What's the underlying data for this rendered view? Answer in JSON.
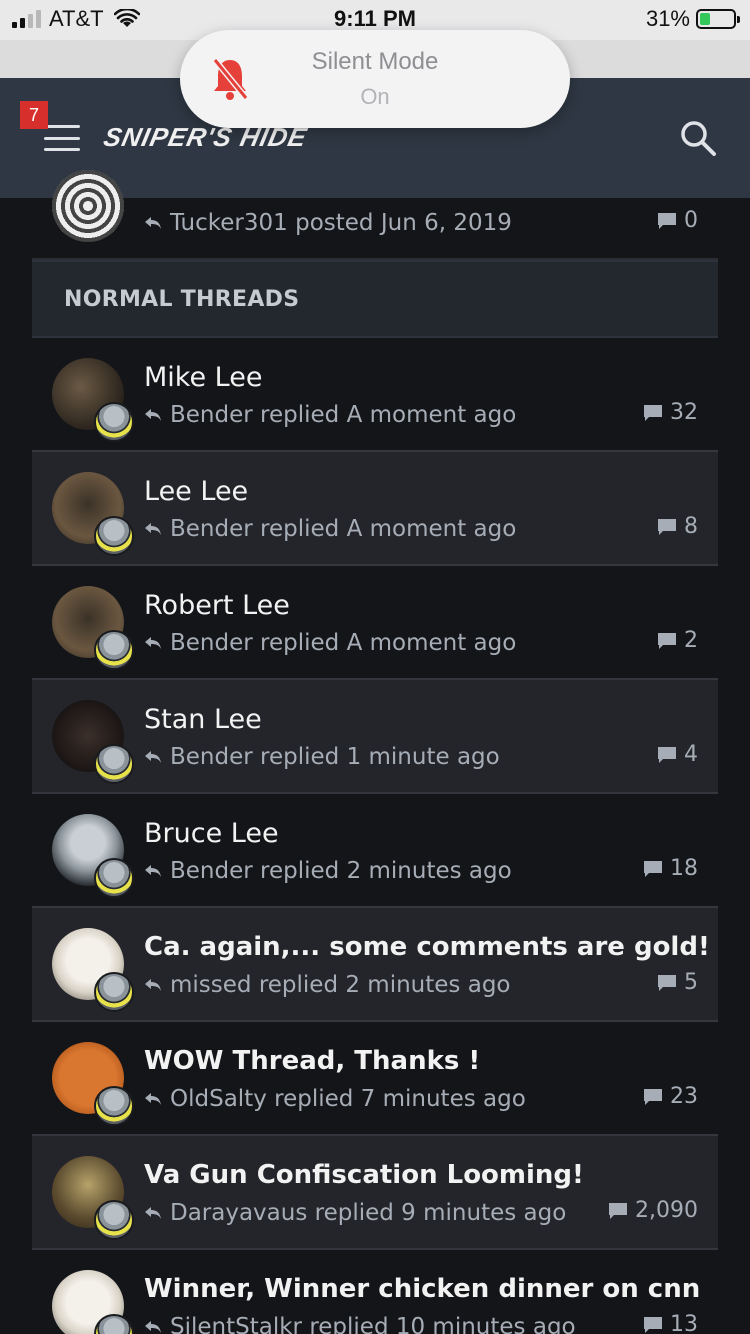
{
  "status_bar": {
    "carrier": "AT&T",
    "time": "9:11 PM",
    "battery": "31%",
    "battery_level": 0.31,
    "charging_color": "#34c759"
  },
  "toast": {
    "title": "Silent Mode",
    "subtitle": "On",
    "icon": "bell-slash-icon"
  },
  "header": {
    "badge": "7",
    "logo": "SNIPER'S HIDE",
    "menu_icon": "hamburger-icon",
    "search_icon": "search-icon",
    "background": "#2e3743"
  },
  "previous_row": {
    "meta": "Tucker301 posted Jun 6, 2019",
    "count": "0"
  },
  "section": {
    "title": "NORMAL THREADS"
  },
  "threads": [
    {
      "title": "Mike Lee",
      "meta": "Bender replied A moment ago",
      "count": "32",
      "bold": false
    },
    {
      "title": "Lee Lee",
      "meta": "Bender replied A moment ago",
      "count": "8",
      "bold": false
    },
    {
      "title": "Robert Lee",
      "meta": "Bender replied A moment ago",
      "count": "2",
      "bold": false
    },
    {
      "title": "Stan Lee",
      "meta": "Bender replied 1 minute ago",
      "count": "4",
      "bold": false
    },
    {
      "title": "Bruce Lee",
      "meta": "Bender replied 2 minutes ago",
      "count": "18",
      "bold": false
    },
    {
      "title": "Ca. again,... some comments are gold!",
      "meta": "missed replied 2 minutes ago",
      "count": "5",
      "bold": true
    },
    {
      "title": "WOW Thread, Thanks !",
      "meta": "OldSalty replied 7 minutes ago",
      "count": "23",
      "bold": true
    },
    {
      "title": "Va Gun Confiscation Looming!",
      "meta": "Darayavaus replied 9 minutes ago",
      "count": "2,090",
      "bold": true
    },
    {
      "title": "Winner, Winner chicken dinner on cnn",
      "meta": "SilentStalkr replied 10 minutes ago",
      "count": "13",
      "bold": true
    }
  ]
}
